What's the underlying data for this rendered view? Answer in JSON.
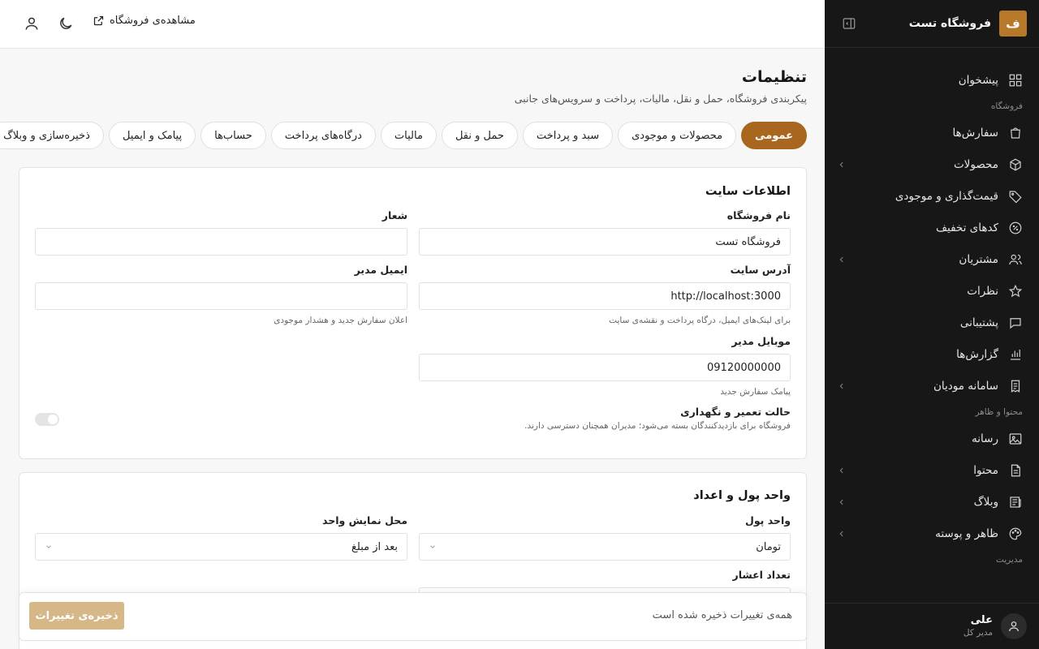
{
  "sidebar": {
    "logo_letter": "ف",
    "brand": "فروشگاه تست",
    "dashboard": "پیشخوان",
    "section_store": "فروشگاه",
    "items_store": [
      {
        "label": "سفارش‌ها",
        "icon": "bag-icon",
        "chevron": false
      },
      {
        "label": "محصولات",
        "icon": "box-icon",
        "chevron": true
      },
      {
        "label": "قیمت‌گذاری و موجودی",
        "icon": "tag-icon",
        "chevron": false
      },
      {
        "label": "کدهای تخفیف",
        "icon": "discount-icon",
        "chevron": false
      },
      {
        "label": "مشتریان",
        "icon": "users-icon",
        "chevron": true
      },
      {
        "label": "نظرات",
        "icon": "star-icon",
        "chevron": false
      },
      {
        "label": "پشتیبانی",
        "icon": "chat-icon",
        "chevron": false
      },
      {
        "label": "گزارش‌ها",
        "icon": "chart-icon",
        "chevron": false
      },
      {
        "label": "سامانه مودیان",
        "icon": "receipt-icon",
        "chevron": true
      }
    ],
    "section_content": "محتوا و ظاهر",
    "items_content": [
      {
        "label": "رسانه",
        "icon": "image-icon",
        "chevron": false
      },
      {
        "label": "محتوا",
        "icon": "document-icon",
        "chevron": true
      },
      {
        "label": "وبلاگ",
        "icon": "newspaper-icon",
        "chevron": true
      },
      {
        "label": "ظاهر و پوسته",
        "icon": "palette-icon",
        "chevron": true
      }
    ],
    "section_admin": "مدیریت",
    "user_name": "علی",
    "user_role": "مدیر کل"
  },
  "topbar": {
    "view_store": "مشاهده‌ی فروشگاه"
  },
  "page": {
    "title": "تنظیمات",
    "subtitle": "پیکربندی فروشگاه، حمل و نقل، مالیات، پرداخت و سرویس‌های جانبی",
    "tabs": [
      "عمومی",
      "محصولات و موجودی",
      "سبد و پرداخت",
      "حمل و نقل",
      "مالیات",
      "درگاه‌های پرداخت",
      "حساب‌ها",
      "پیامک و ایمیل",
      "ذخیره‌سازی و وبلاگ",
      ""
    ]
  },
  "site_info": {
    "title": "اطلاعات سایت",
    "store_name_label": "نام فروشگاه",
    "store_name_value": "فروشگاه تست",
    "slogan_label": "شعار",
    "slogan_value": "",
    "site_url_label": "آدرس سایت",
    "site_url_value": "http://localhost:3000",
    "site_url_hint": "برای لینک‌های ایمیل، درگاه پرداخت و نقشه‌ی سایت",
    "admin_email_label": "ایمیل مدیر",
    "admin_email_value": "",
    "admin_email_hint": "اعلان سفارش جدید و هشدار موجودی",
    "admin_mobile_label": "موبایل مدیر",
    "admin_mobile_value": "09120000000",
    "admin_mobile_hint": "پیامک سفارش جدید",
    "maintenance_label": "حالت تعمیر و نگهداری",
    "maintenance_hint": "فروشگاه برای بازدیدکنندگان بسته می‌شود؛ مدیران همچنان دسترسی دارند."
  },
  "currency": {
    "title": "واحد پول و اعداد",
    "currency_label": "واحد پول",
    "currency_value": "تومان",
    "position_label": "محل نمایش واحد",
    "position_value": "بعد از مبلغ",
    "decimals_label": "تعداد اعشار"
  },
  "savebar": {
    "status": "همه‌ی تغییرات ذخیره شده است",
    "button": "ذخیره‌ی تغییرات"
  }
}
